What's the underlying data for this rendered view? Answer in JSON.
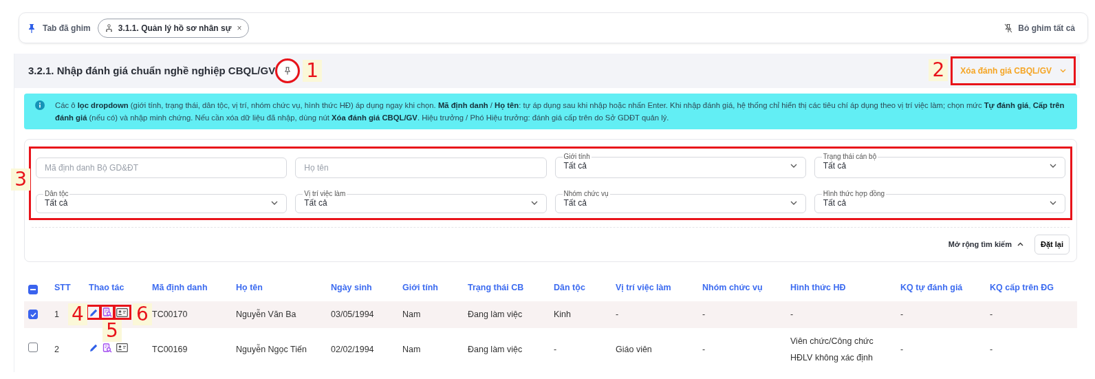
{
  "pinned_bar": {
    "label": "Tab đã ghim",
    "tabs": [
      {
        "label": "3.1.1. Quản lý hồ sơ nhân sự",
        "selected": false,
        "close": "×"
      }
    ],
    "unpin_all": "Bỏ ghim tất cả"
  },
  "page": {
    "title": "3.2.1. Nhập đánh giá chuẩn nghề nghiệp CBQL/GV",
    "action_button": "Xóa đánh giá CBQL/GV"
  },
  "notice": "Các ô **lọc dropdown** (giới tính, trạng thái, dân tộc, vị trí, nhóm chức vụ, hình thức HĐ) áp dụng ngay khi chọn. **Mã định danh** / **Họ tên**: tự áp dụng sau khi nhập hoặc nhấn Enter. Khi nhập đánh giá, hệ thống chỉ hiển thị các tiêu chí áp dụng theo vị trí việc làm; chọn mức **Tự đánh giá**, **Cấp trên đánh giá** (nếu có) và nhập minh chứng. Nếu cần xóa dữ liệu đã nhập, dùng nút **Xóa đánh giá CBQL/GV**. Hiệu trưởng / Phó Hiệu trưởng: đánh giá cấp trên do Sở GDĐT quản lý.",
  "filters": [
    {
      "kind": "text",
      "placeholder": "Mã định danh Bộ GD&ĐT"
    },
    {
      "kind": "text",
      "placeholder": "Họ tên"
    },
    {
      "kind": "select",
      "label": "Giới tính",
      "value": "Tất cả"
    },
    {
      "kind": "select",
      "label": "Trạng thái cán bộ",
      "value": "Tất cả"
    },
    {
      "kind": "select",
      "label": "Dân tộc",
      "value": "Tất cả"
    },
    {
      "kind": "select",
      "label": "Vị trí việc làm",
      "value": "Tất cả"
    },
    {
      "kind": "select",
      "label": "Nhóm chức vụ",
      "value": "Tất cả"
    },
    {
      "kind": "select",
      "label": "Hình thức hợp đồng",
      "value": "Tất cả"
    }
  ],
  "filter_actions": {
    "expand": "Mở rộng tìm kiếm",
    "expanded": true,
    "reset": "Đặt lại"
  },
  "table": {
    "select_all_partial": true,
    "columns": [
      "STT",
      "Thao tác",
      "Mã định danh",
      "Họ tên",
      "Ngày sinh",
      "Giới tính",
      "Trạng thái CB",
      "Dân tộc",
      "Vị trí việc làm",
      "Nhóm chức vụ",
      "Hình thức HĐ",
      "KQ tự đánh giá",
      "KQ cấp trên ĐG"
    ],
    "rows": [
      {
        "selected": true,
        "cells": [
          "1",
          "",
          "TC00170",
          "Nguyễn Văn Ba",
          "03/05/1994",
          "Nam",
          "Đang làm việc",
          "Kinh",
          "-",
          "-",
          "-",
          "-",
          "-"
        ]
      },
      {
        "selected": false,
        "cells": [
          "2",
          "",
          "TC00169",
          "Nguyễn Ngọc Tiến",
          "02/02/1994",
          "Nam",
          "Đang làm việc",
          "-",
          "Giáo viên",
          "-",
          "Viên chức/Công chức HĐLV không xác định",
          "-",
          "-"
        ]
      }
    ]
  },
  "annotations": [
    {
      "label": "1"
    },
    {
      "label": "2"
    },
    {
      "label": "3"
    },
    {
      "label": "4"
    },
    {
      "label": "5"
    },
    {
      "label": "6"
    }
  ]
}
